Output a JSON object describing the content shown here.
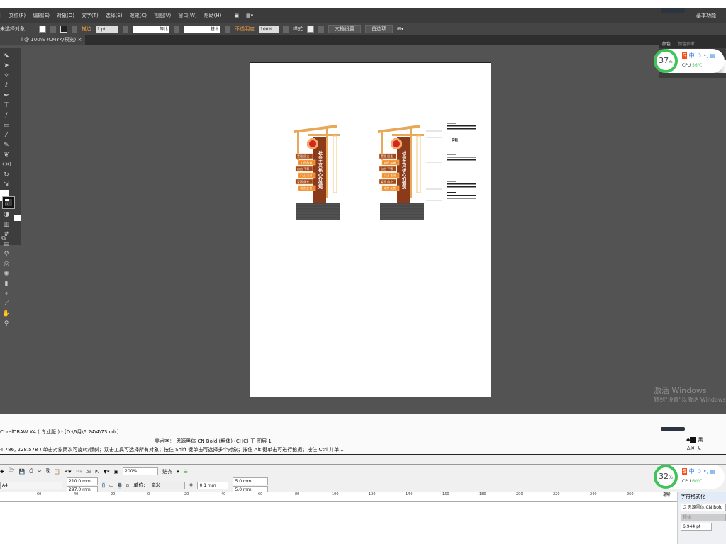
{
  "illustrator": {
    "menu": [
      "文件(F)",
      "编辑(E)",
      "对象(O)",
      "文字(T)",
      "选择(S)",
      "效果(C)",
      "视图(V)",
      "窗口(W)",
      "帮助(H)"
    ],
    "workspace": "基本功能",
    "control": {
      "selection": "未选择对象",
      "stroke_label": "描边",
      "stroke_value": "1 pt",
      "profile1": "等比",
      "profile2": "基本",
      "opacity_label": "不透明度",
      "opacity_value": "100%",
      "style_label": "样式",
      "doc_setup": "文档设置",
      "prefs": "首选项"
    },
    "doc_tab": "i @ 100% (CMYK/预览)",
    "panel_tabs": [
      "颜色",
      "颜色参考"
    ],
    "artwork": {
      "title": "社会主义核心价值观",
      "values": [
        "富强 民主",
        "文明 和谐",
        "自由 平等",
        "公正 法治",
        "爱国 敬业",
        "诚信 友善"
      ],
      "callout": "安装"
    },
    "activation": {
      "line1": "激活 Windows",
      "line2": "转到\"设置\"以激活 Windows"
    }
  },
  "monitor1": {
    "percent": "37",
    "unit": "%",
    "cpu": "CPU",
    "temp": "56℃",
    "ime": "中"
  },
  "monitor2": {
    "percent": "32",
    "unit": "%",
    "cpu": "CPU",
    "temp": "60℃",
    "ime": "中"
  },
  "corel": {
    "title": "CorelDRAW X4 ( 专业版 ) - [D:\\6月\\6.24\\4\\73.cdr]",
    "object_info": "美术字： 思源黑体 CN Bold (粗体) (CHC) 于 图层 1",
    "status": "4.786, 228.578 )   单击对象两次可旋转/倾斜；双击工具可选择所有对象；按住 Shift 键单击可选择多个对象；按住 Alt 键单击可进行挖掘；按住 Ctrl 并单...",
    "fill": "黑",
    "outline": "无",
    "zoom": "200%",
    "snap": "贴齐",
    "page": "A4",
    "width": "210.0 mm",
    "height": "297.0 mm",
    "unit_label": "单位:",
    "unit": "毫米",
    "nudge": "0.1 mm",
    "dup_x": "5.0 mm",
    "dup_y": "5.0 mm",
    "ruler": [
      "60",
      "40",
      "20",
      "0",
      "20",
      "40",
      "60",
      "80",
      "100",
      "120",
      "140",
      "160",
      "180",
      "200",
      "220",
      "240",
      "260",
      "280"
    ],
    "ruler_unit": "毫米",
    "docker": {
      "title": "字符格式化",
      "font": "思源黑体 CN Bold",
      "weight": "粗体",
      "size": "6.944 pt"
    }
  }
}
